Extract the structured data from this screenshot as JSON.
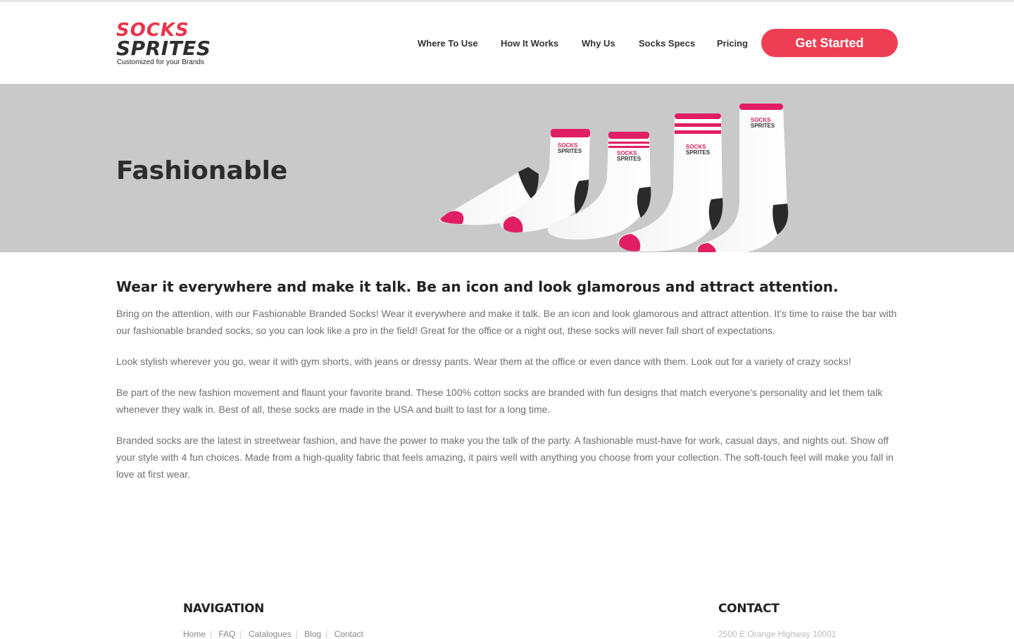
{
  "brand": {
    "logo_top": "SOCKS",
    "logo_bottom": "SPRITES",
    "tagline": "Customized for your Brands",
    "accent_color": "#ee3e54"
  },
  "nav": {
    "items": [
      {
        "label": "Where To Use"
      },
      {
        "label": "How It Works"
      },
      {
        "label": "Why Us"
      },
      {
        "label": "Socks Specs"
      },
      {
        "label": "Pricing"
      }
    ],
    "cta_label": "Get Started"
  },
  "hero": {
    "title": "Fashionable",
    "image_icon": "branded-socks-lineup-image"
  },
  "main": {
    "headline": "Wear it everywhere and make it talk. Be an icon and look glamorous and attract attention.",
    "paragraphs": [
      "Bring on the attention, with our Fashionable Branded Socks! Wear it everywhere and make it talk. Be an icon and look glamorous and attract attention. It’s time to raise the bar with our fashionable branded socks, so you can look like a pro in the field! Great for the office or a night out, these socks will never fall short of expectations.",
      "Look stylish wherever you go, wear it with gym shorts, with jeans or dressy pants. Wear them at the office or even dance with them. Look out for a variety of crazy socks!",
      "Be part of the new fashion movement and flaunt your favorite brand. These 100% cotton socks are branded with fun designs that match everyone’s personality and let them talk whenever they walk in. Best of all, these socks are made in the USA and built to last for a long time.",
      "Branded socks are the latest in streetwear fashion, and have the power to make you the talk of the party. A fashionable must-have for work, casual days, and nights out. Show off your style with 4 fun choices. Made from a high-quality fabric that feels amazing, it pairs well with anything you choose from your collection. The soft-touch feel will make you fall in love at first wear."
    ]
  },
  "footer": {
    "nav_heading": "NAVIGATION",
    "contact_heading": "CONTACT",
    "links": [
      {
        "label": "Home"
      },
      {
        "label": "FAQ"
      },
      {
        "label": "Catalogues"
      },
      {
        "label": "Blog"
      },
      {
        "label": "Contact"
      }
    ],
    "address": "2500 E Orange Highway 10001"
  }
}
